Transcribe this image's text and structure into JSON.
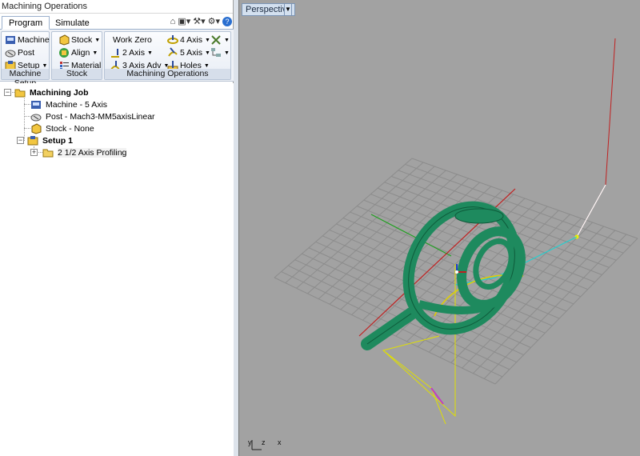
{
  "panel": {
    "title": "Machining Operations",
    "tabs": [
      {
        "label": "Program"
      },
      {
        "label": "Simulate"
      }
    ],
    "help_icon": "?"
  },
  "ribbon": {
    "machine_setup": {
      "label": "Machine Setup",
      "machine": "Machine",
      "post": "Post",
      "setup": "Setup"
    },
    "stock": {
      "label": "Stock",
      "stock": "Stock",
      "align": "Align",
      "material": "Material"
    },
    "machining_ops": {
      "label": "Machining Operations",
      "work_zero": "Work Zero",
      "two_axis": "2 Axis",
      "three_axis_adv": "3 Axis Adv",
      "four_axis": "4 Axis",
      "five_axis": "5 Axis",
      "holes": "Holes"
    }
  },
  "tree": {
    "root": "Machining Job",
    "machine": "Machine - 5 Axis",
    "post": "Post - Mach3-MM5axisLinear",
    "stock": "Stock - None",
    "setup": "Setup 1",
    "operation": "2 1/2 Axis Profiling"
  },
  "viewport": {
    "view_name": "Perspective",
    "axis_labels": [
      "y",
      "z",
      "x"
    ],
    "colors": {
      "background": "#a2a2a2",
      "grid": "#8c8c8c",
      "model": "#1e8a5e",
      "x_axis": "#c02020",
      "y_axis": "#20a020",
      "toolpath_yellow": "#e0e000",
      "toolpath_cyan": "#20d0d0"
    }
  }
}
